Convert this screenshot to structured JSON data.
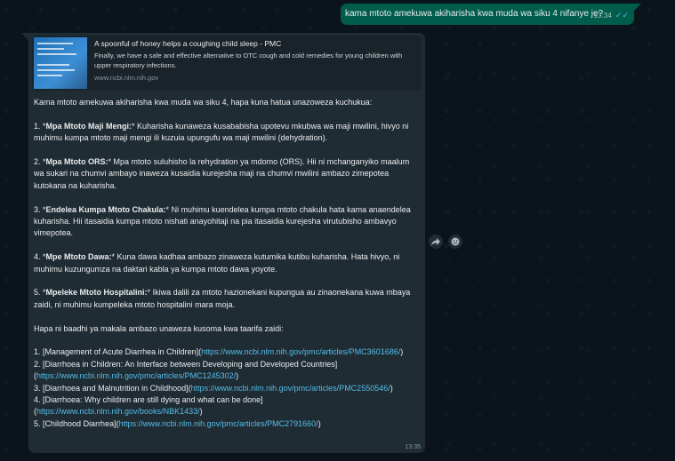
{
  "outgoing": {
    "text": "kama mtoto amekuwa akiharisha kwa muda wa siku 4 nifanye je?",
    "time": "13:34",
    "ticks": "✓✓"
  },
  "link_preview": {
    "title": "A spoonful of honey helps a coughing child sleep - PMC",
    "description": "Finally, we have a safe and effective alternative to OTC cough and cold remedies for young children with upper respiratory infections.",
    "url": "www.ncbi.nlm.nih.gov"
  },
  "reply": {
    "intro": "Kama mtoto amekuwa akiharisha kwa muda wa siku 4, hapa kuna hatua unazoweza kuchukua:",
    "steps": [
      {
        "num": "1.",
        "title": "Mpa Mtoto Maji Mengi:",
        "text": " Kuharisha kunaweza kusababisha upotevu mkubwa wa maji mwilini, hivyo ni muhimu kumpa mtoto maji mengi ili kuzuia upungufu wa maji mwilini (dehydration)."
      },
      {
        "num": "2.",
        "title": "Mpa Mtoto ORS:",
        "text": " Mpa mtoto suluhisho la rehydration ya mdomo (ORS). Hii ni mchanganyiko maalum wa sukari na chumvi ambayo inaweza kusaidia kurejesha maji na chumvi mwilini ambazo zimepotea kutokana na kuharisha."
      },
      {
        "num": "3.",
        "title": "Endelea Kumpa Mtoto Chakula:",
        "text": " Ni muhimu kuendelea kumpa mtoto chakula hata kama anaendelea kuharisha. Hii itasaidia kumpa mtoto nishati anayohitaji na pia itasaidia kurejesha virutubisho ambavyo vimepotea."
      },
      {
        "num": "4.",
        "title": "Mpe Mtoto Dawa:",
        "text": " Kuna dawa kadhaa ambazo zinaweza kutumika kutibu kuharisha. Hata hivyo, ni muhimu kuzungumza na daktari kabla ya kumpa mtoto dawa yoyote."
      },
      {
        "num": "5.",
        "title": "Mpeleke Mtoto Hospitalini:",
        "text": " Ikiwa dalili za mtoto hazionekani kupungua au zinaonekana kuwa mbaya zaidi, ni muhimu kumpeleka mtoto hospitalini mara moja."
      }
    ],
    "refs_intro": "Hapa ni baadhi ya makala ambazo unaweza kusoma kwa taarifa zaidi:",
    "refs": [
      {
        "num": "1.",
        "label": "[Management of Acute Diarrhea in Children](",
        "url": "https://www.ncbi.nlm.nih.gov/pmc/articles/PMC3601686/",
        "close": ")"
      },
      {
        "num": "2.",
        "label": "[Diarrhoea in Children: An Interface between Developing and Developed Countries](",
        "url": "https://www.ncbi.nlm.nih.gov/pmc/articles/PMC1245302/",
        "close": ")"
      },
      {
        "num": "3.",
        "label": "[Diarrhoea and Malnutrition in Childhood](",
        "url": "https://www.ncbi.nlm.nih.gov/pmc/articles/PMC2550546/",
        "close": ")"
      },
      {
        "num": "4.",
        "label": "[Diarrhoea: Why children are still dying and what can be done](",
        "url": "https://www.ncbi.nlm.nih.gov/books/NBK1433/",
        "close": ")"
      },
      {
        "num": "5.",
        "label": "[Childhood Diarrhea](",
        "url": "https://www.ncbi.nlm.nih.gov/pmc/articles/PMC2791660/",
        "close": ")"
      }
    ],
    "time": "13:35"
  },
  "actions": {
    "forward_icon": "forward-icon",
    "emoji_icon": "emoji-icon"
  },
  "colors": {
    "background": "#0b141a",
    "outgoing_bubble": "#005c4b",
    "incoming_bubble": "#202c33",
    "link": "#53bdeb"
  }
}
